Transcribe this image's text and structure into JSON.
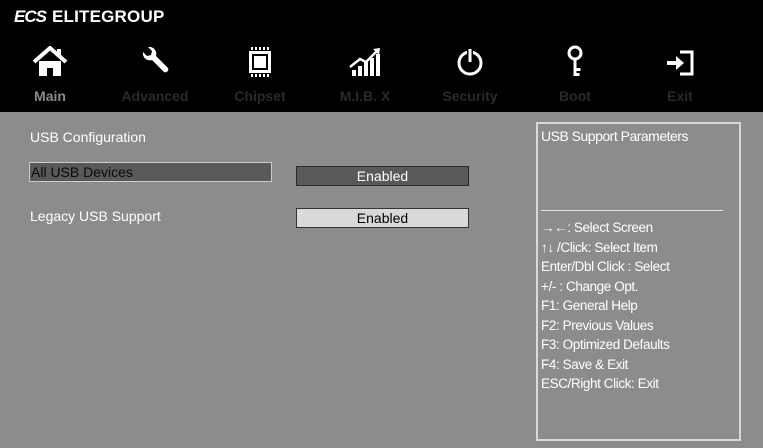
{
  "brand": {
    "logo": "ECS",
    "name": "ELITEGROUP"
  },
  "tabs": [
    {
      "label": "Main",
      "icon": "home-icon"
    },
    {
      "label": "Advanced",
      "icon": "wrench-icon"
    },
    {
      "label": "Chipset",
      "icon": "chip-icon"
    },
    {
      "label": "M.I.B. X",
      "icon": "performance-chart-icon"
    },
    {
      "label": "Security",
      "icon": "power-icon"
    },
    {
      "label": "Boot",
      "icon": "key-icon"
    },
    {
      "label": "Exit",
      "icon": "exit-icon"
    }
  ],
  "colors": {
    "header": "#000000",
    "body": "#8c8c8c",
    "selected": "#595959",
    "value_bg": "#d9d9d9"
  },
  "main": {
    "section_title": "USB Configuration",
    "options": [
      {
        "label": "All USB Devices",
        "value": "Enabled",
        "selected": true
      },
      {
        "label": "Legacy USB Support",
        "value": "Enabled",
        "selected": false
      }
    ]
  },
  "help": {
    "title": "USB Support Parameters",
    "keys": [
      "→←: Select Screen",
      "↑↓ /Click: Select Item",
      "Enter/Dbl Click : Select",
      "+/- : Change Opt.",
      "F1: General Help",
      "F2: Previous Values",
      "F3: Optimized Defaults",
      "F4: Save & Exit",
      "ESC/Right Click: Exit"
    ]
  }
}
